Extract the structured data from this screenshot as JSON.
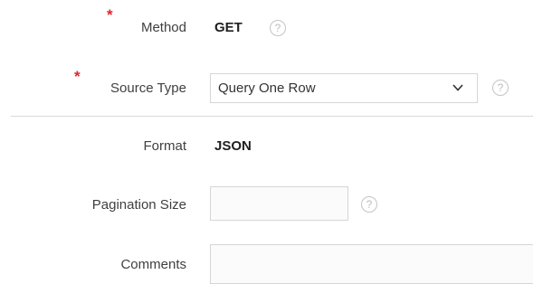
{
  "form": {
    "method": {
      "label": "Method",
      "required_mark": "*",
      "value": "GET",
      "help_glyph": "?"
    },
    "source_type": {
      "label": "Source Type",
      "required_mark": "*",
      "selected": "Query One Row",
      "help_glyph": "?"
    },
    "format": {
      "label": "Format",
      "value": "JSON"
    },
    "pagination_size": {
      "label": "Pagination Size",
      "value": "",
      "help_glyph": "?"
    },
    "comments": {
      "label": "Comments",
      "value": ""
    }
  },
  "colors": {
    "required": "#e0262b",
    "border": "#d6d6d6",
    "help": "#bdbdbd"
  },
  "icons": {
    "help": "help-circle-icon",
    "dropdown": "chevron-down-icon"
  }
}
